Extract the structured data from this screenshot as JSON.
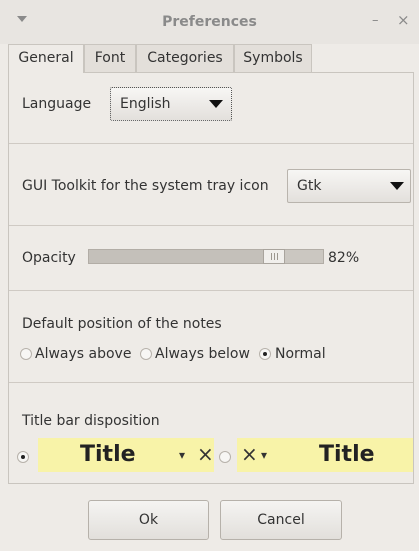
{
  "window": {
    "title": "Preferences",
    "menu_icon": "window-menu-icon",
    "minimize_glyph": "–",
    "close_glyph": "×"
  },
  "tabs": [
    {
      "label": "General",
      "active": true
    },
    {
      "label": "Font",
      "active": false
    },
    {
      "label": "Categories",
      "active": false
    },
    {
      "label": "Symbols",
      "active": false
    }
  ],
  "general": {
    "language": {
      "label": "Language",
      "value": "English"
    },
    "toolkit": {
      "label": "GUI Toolkit for the system tray icon",
      "value": "Gtk"
    },
    "opacity": {
      "label": "Opacity",
      "value_text": "82%",
      "value": 0.82
    },
    "position": {
      "label": "Default position of the notes",
      "options": [
        {
          "label": "Always above",
          "selected": false
        },
        {
          "label": "Always below",
          "selected": false
        },
        {
          "label": "Normal",
          "selected": true
        }
      ]
    },
    "titlebar": {
      "label": "Title bar disposition",
      "options": [
        {
          "title": "Title",
          "selected": true,
          "menu_glyph": "▾",
          "close_glyph": "×"
        },
        {
          "title": "Title",
          "selected": false,
          "menu_glyph": "▾",
          "close_glyph": "×"
        }
      ]
    }
  },
  "buttons": {
    "ok": "Ok",
    "cancel": "Cancel"
  },
  "colors": {
    "note_preview": "#f8f3a8",
    "background": "#eeebe7"
  }
}
